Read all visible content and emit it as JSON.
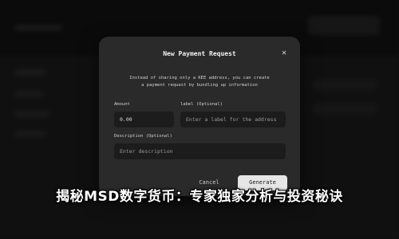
{
  "dialog": {
    "title": "New Payment Request",
    "close_icon": "close-icon",
    "description_line1": "Instead of sharing only a KEE address, you can create",
    "description_line2": "a payment request by bundling up information",
    "amount": {
      "label": "Amount",
      "value": "0.00"
    },
    "label_field": {
      "label": "label (Optional)",
      "placeholder": "Enter a label for the address"
    },
    "description_field": {
      "label": "Description (Optional)",
      "placeholder": "Enter description"
    },
    "cancel_label": "Cancel",
    "generate_label": "Generate"
  },
  "headline": "揭秘MSD数字货币：专家独家分析与投资秘诀"
}
